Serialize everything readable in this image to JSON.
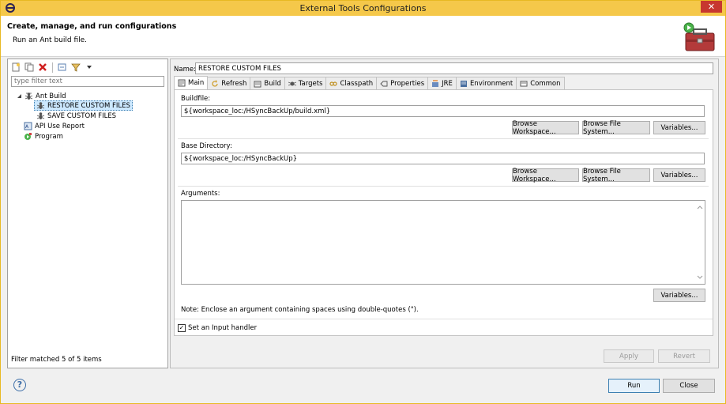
{
  "window": {
    "title": "External Tools Configurations",
    "close_glyph": "✕"
  },
  "header": {
    "title": "Create, manage, and run configurations",
    "subtitle": "Run an Ant build file."
  },
  "left": {
    "filter_placeholder": "type filter text",
    "tree": [
      {
        "label": "Ant Build",
        "icon": "ant-icon",
        "expanded": true,
        "level": 0
      },
      {
        "label": "RESTORE CUSTOM FILES",
        "icon": "ant-icon",
        "level": 1,
        "selected": true
      },
      {
        "label": "SAVE CUSTOM FILES",
        "icon": "ant-icon",
        "level": 1
      },
      {
        "label": "API Use Report",
        "icon": "api-report-icon",
        "level": 0
      },
      {
        "label": "Program",
        "icon": "program-icon",
        "level": 0
      }
    ],
    "status": "Filter matched 5 of 5 items"
  },
  "right": {
    "name_label": "Name:",
    "name_value": "RESTORE CUSTOM FILES",
    "tabs": [
      "Main",
      "Refresh",
      "Build",
      "Targets",
      "Classpath",
      "Properties",
      "JRE",
      "Environment",
      "Common"
    ],
    "active_tab": "Main",
    "buildfile": {
      "label": "Buildfile:",
      "value": "${workspace_loc:/HSyncBackUp/build.xml}"
    },
    "basedir": {
      "label": "Base Directory:",
      "value": "${workspace_loc:/HSyncBackUp}"
    },
    "browse_workspace": "Browse Workspace...",
    "browse_fs": "Browse File System...",
    "variables": "Variables...",
    "arguments_label": "Arguments:",
    "arguments_value": "",
    "note": "Note: Enclose an argument containing spaces using double-quotes (\").",
    "input_handler": {
      "label": "Set an Input handler",
      "checked": true
    },
    "apply": "Apply",
    "revert": "Revert"
  },
  "footer": {
    "run": "Run",
    "close": "Close"
  }
}
